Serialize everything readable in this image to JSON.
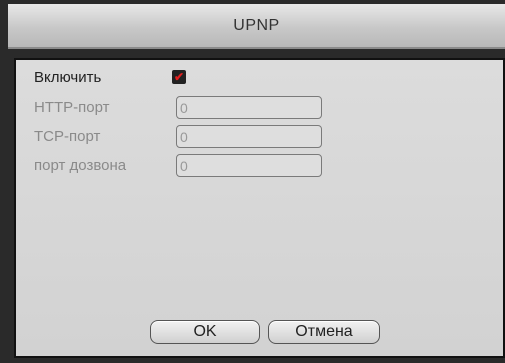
{
  "dialog": {
    "title": "UPNP"
  },
  "form": {
    "enable": {
      "label": "Включить",
      "checked": true
    },
    "http_port": {
      "label": "HTTP-порт",
      "value": "0"
    },
    "tcp_port": {
      "label": "TCP-порт",
      "value": "0"
    },
    "dial_port": {
      "label": "порт дозвона",
      "value": "0"
    }
  },
  "buttons": {
    "ok": "OK",
    "cancel": "Отмена"
  }
}
